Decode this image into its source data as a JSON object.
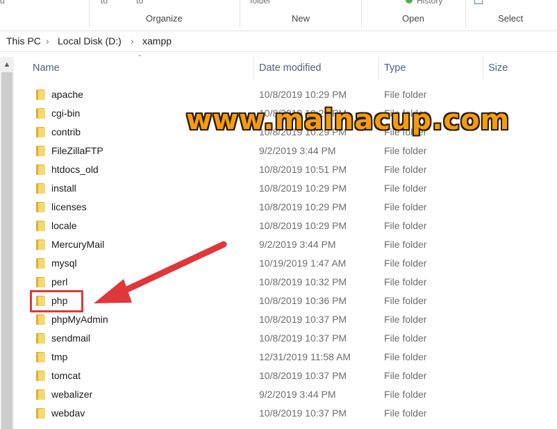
{
  "ribbon": {
    "partial_left": "d",
    "move_to": "to",
    "copy_to": "to",
    "new_folder": "folder",
    "history": "History",
    "groups": {
      "organize": "Organize",
      "new": "New",
      "open": "Open",
      "select": "Select"
    }
  },
  "breadcrumb": [
    "This PC",
    "Local Disk (D:)",
    "xampp"
  ],
  "columns": {
    "name": "Name",
    "date": "Date modified",
    "type": "Type",
    "size": "Size"
  },
  "rows": [
    {
      "name": "apache",
      "date": "10/8/2019 10:29 PM",
      "type": "File folder"
    },
    {
      "name": "cgi-bin",
      "date": "10/8/2019 10:29 PM",
      "type": "File folder"
    },
    {
      "name": "contrib",
      "date": "10/8/2019 10:29 PM",
      "type": "File folder"
    },
    {
      "name": "FileZillaFTP",
      "date": "9/2/2019 3:44 PM",
      "type": "File folder"
    },
    {
      "name": "htdocs_old",
      "date": "10/8/2019 10:51 PM",
      "type": "File folder"
    },
    {
      "name": "install",
      "date": "10/8/2019 10:29 PM",
      "type": "File folder"
    },
    {
      "name": "licenses",
      "date": "10/8/2019 10:29 PM",
      "type": "File folder"
    },
    {
      "name": "locale",
      "date": "10/8/2019 10:29 PM",
      "type": "File folder"
    },
    {
      "name": "MercuryMail",
      "date": "9/2/2019 3:44 PM",
      "type": "File folder"
    },
    {
      "name": "mysql",
      "date": "10/19/2019 1:47 AM",
      "type": "File folder"
    },
    {
      "name": "perl",
      "date": "10/8/2019 10:32 PM",
      "type": "File folder"
    },
    {
      "name": "php",
      "date": "10/8/2019 10:36 PM",
      "type": "File folder"
    },
    {
      "name": "phpMyAdmin",
      "date": "10/8/2019 10:37 PM",
      "type": "File folder"
    },
    {
      "name": "sendmail",
      "date": "10/8/2019 10:37 PM",
      "type": "File folder"
    },
    {
      "name": "tmp",
      "date": "12/31/2019 11:58 AM",
      "type": "File folder"
    },
    {
      "name": "tomcat",
      "date": "10/8/2019 10:37 PM",
      "type": "File folder"
    },
    {
      "name": "webalizer",
      "date": "9/2/2019 3:44 PM",
      "type": "File folder"
    },
    {
      "name": "webdav",
      "date": "10/8/2019 10:37 PM",
      "type": "File folder"
    }
  ],
  "watermark": "www.mainacup.com",
  "colors": {
    "folder": "#f8d872",
    "highlight": "#e0373b",
    "watermark": "#f39c12",
    "header_text": "#4d6082"
  }
}
